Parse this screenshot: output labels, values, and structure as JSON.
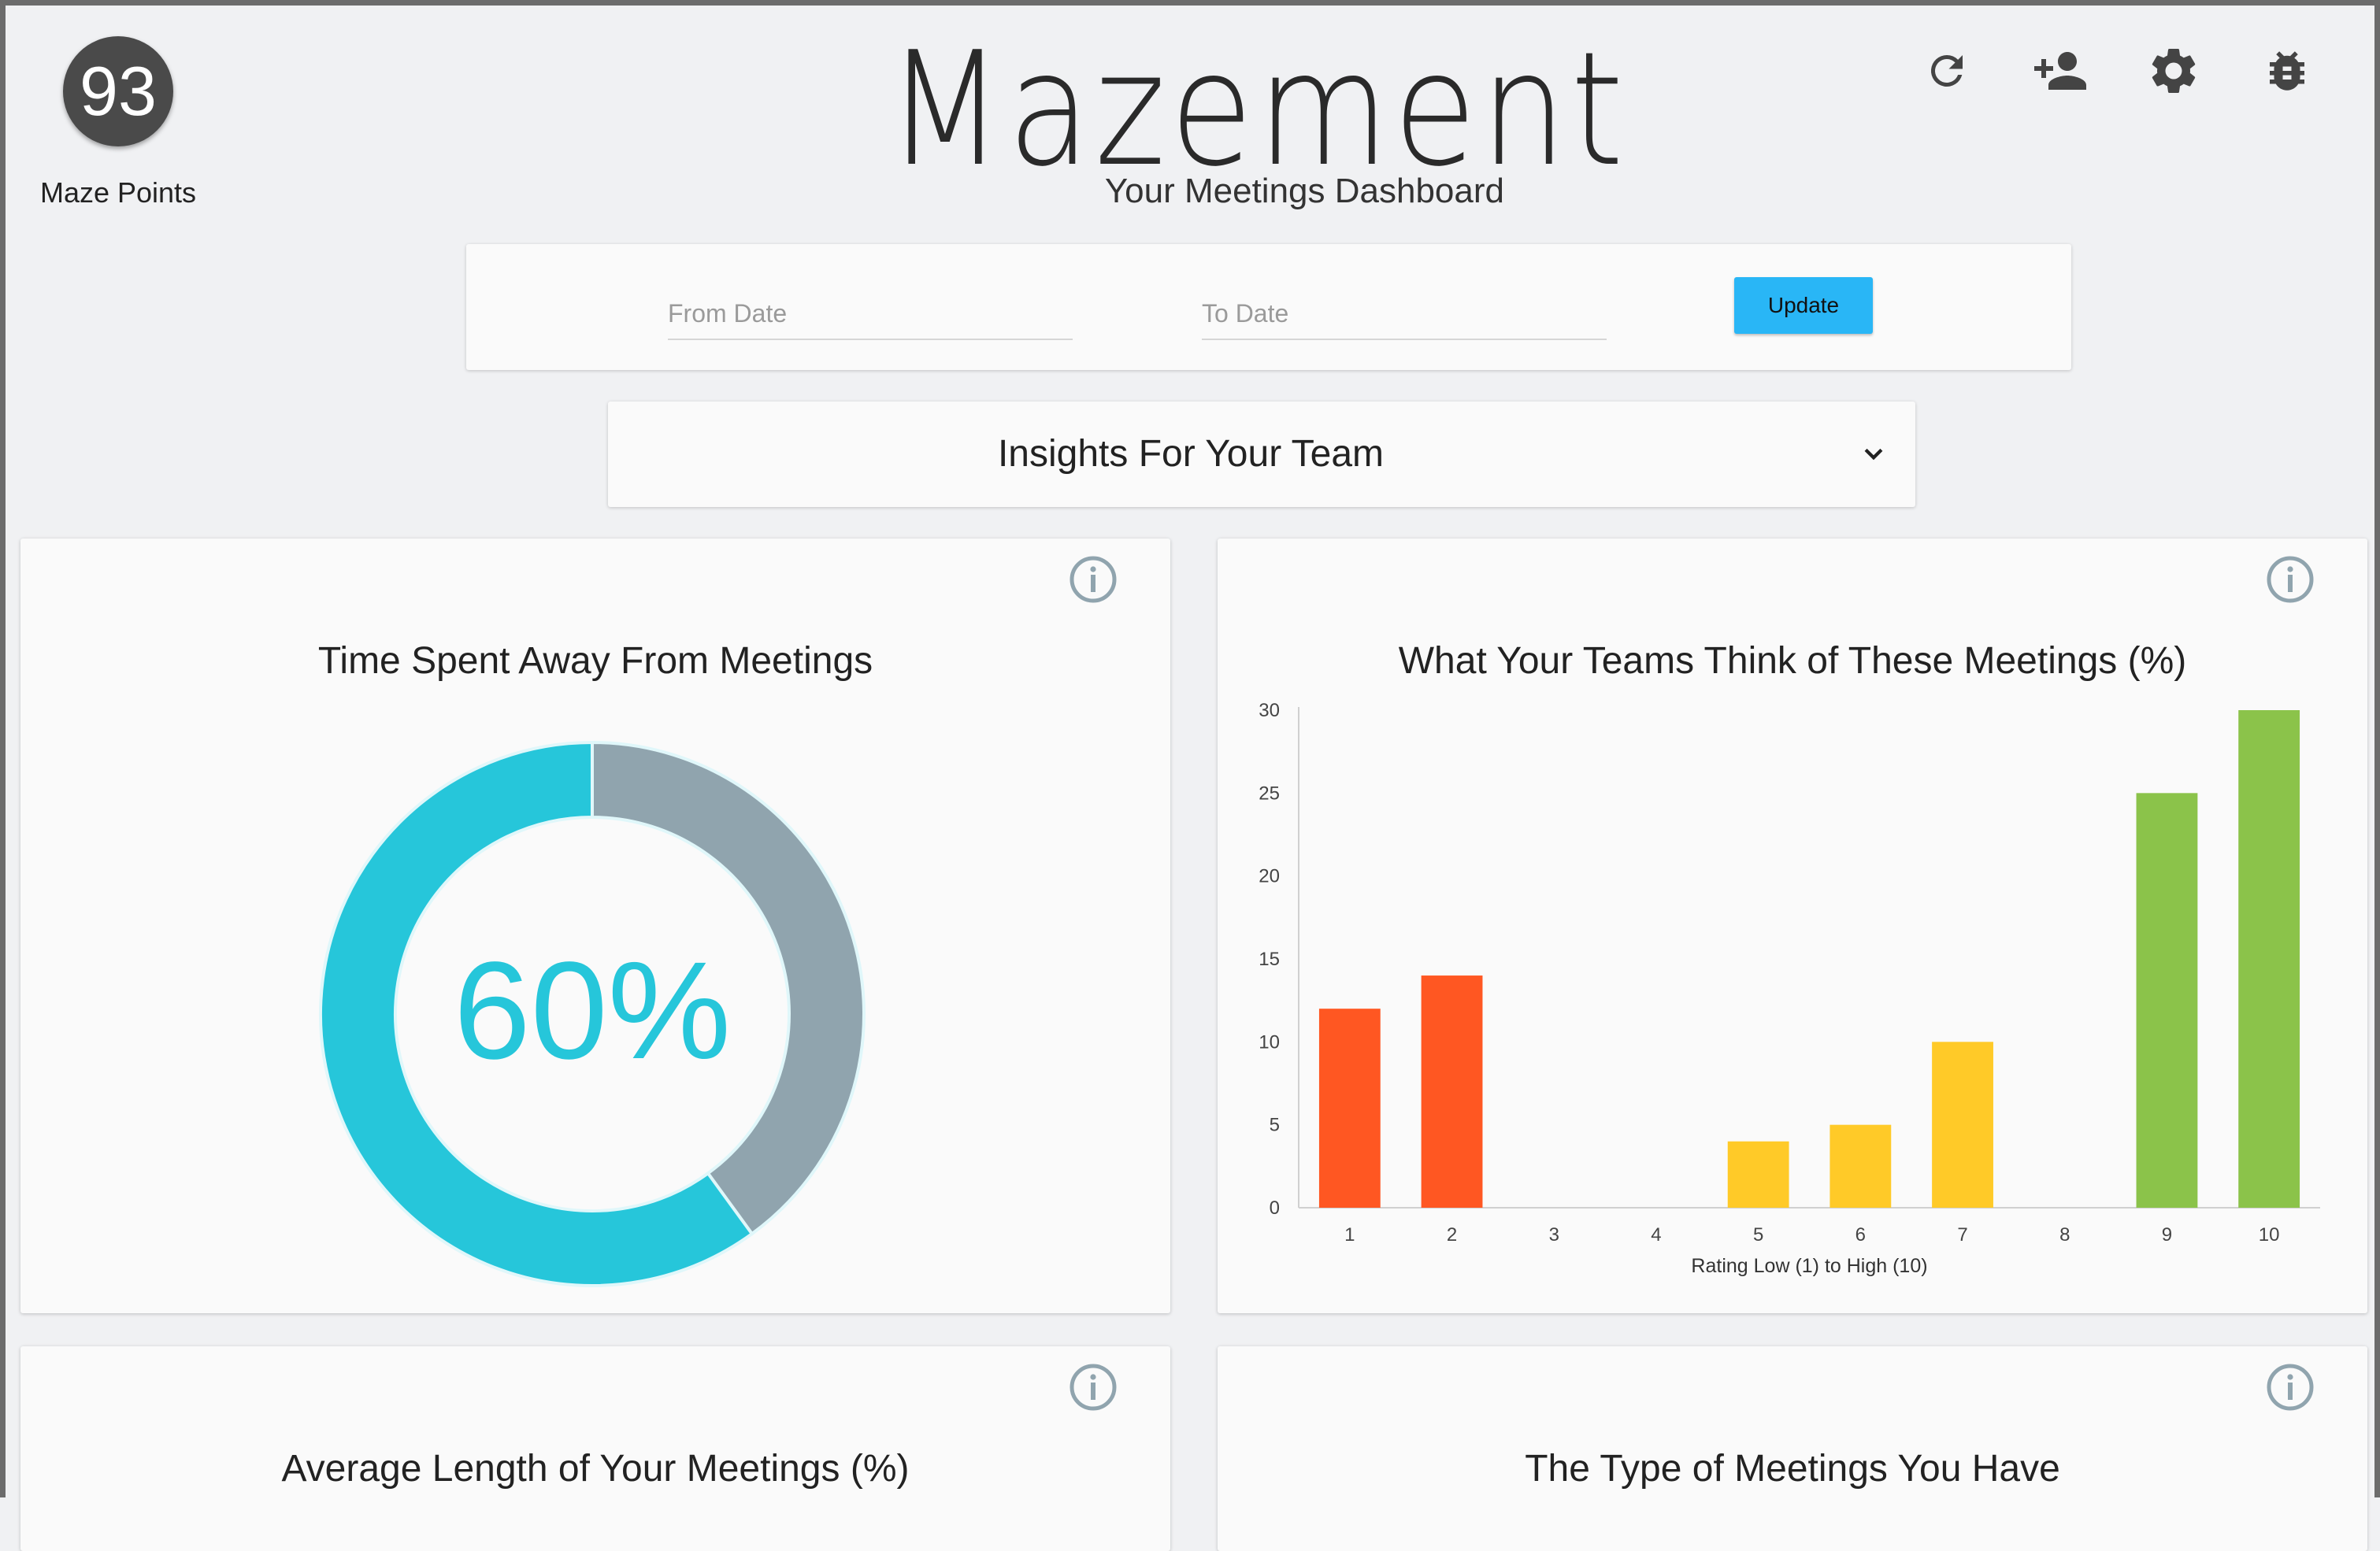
{
  "header": {
    "points_value": "93",
    "points_label": "Maze Points",
    "app_title": "Mazement",
    "subtitle": "Your Meetings Dashboard"
  },
  "filters": {
    "from_placeholder": "From Date",
    "to_placeholder": "To Date",
    "update_label": "Update"
  },
  "insights_dropdown": {
    "selected": "Insights For Your Team"
  },
  "cards": {
    "time_away": {
      "title": "Time Spent Away From Meetings",
      "center_text": "60%",
      "percent_away": 60,
      "colors": {
        "away": "#26c6da",
        "in_meetings": "#90a4ae"
      }
    },
    "ratings": {
      "title": "What Your Teams Think of These Meetings (%)"
    },
    "avg_length": {
      "title": "Average Length of Your Meetings (%)"
    },
    "meeting_types": {
      "title": "The Type of Meetings You Have"
    }
  },
  "chart_data": {
    "type": "bar",
    "title": "What Your Teams Think of These Meetings (%)",
    "xlabel": "Rating Low (1) to High (10)",
    "ylabel": "",
    "categories": [
      "1",
      "2",
      "3",
      "4",
      "5",
      "6",
      "7",
      "8",
      "9",
      "10"
    ],
    "values": [
      12,
      14,
      0,
      0,
      4,
      5,
      10,
      0,
      25,
      30
    ],
    "bar_colors": [
      "#ff5722",
      "#ff5722",
      "#ff5722",
      "#ffca28",
      "#ffca28",
      "#ffca28",
      "#ffca28",
      "#8bc34a",
      "#8bc34a",
      "#8bc34a"
    ],
    "yticks": [
      0,
      5,
      10,
      15,
      20,
      25,
      30
    ],
    "ylim": [
      0,
      30
    ],
    "grid": false,
    "legend": "none"
  },
  "icons": [
    "refresh-icon",
    "add-person-icon",
    "gear-icon",
    "bug-icon",
    "info-icon",
    "chevron-down-icon"
  ]
}
